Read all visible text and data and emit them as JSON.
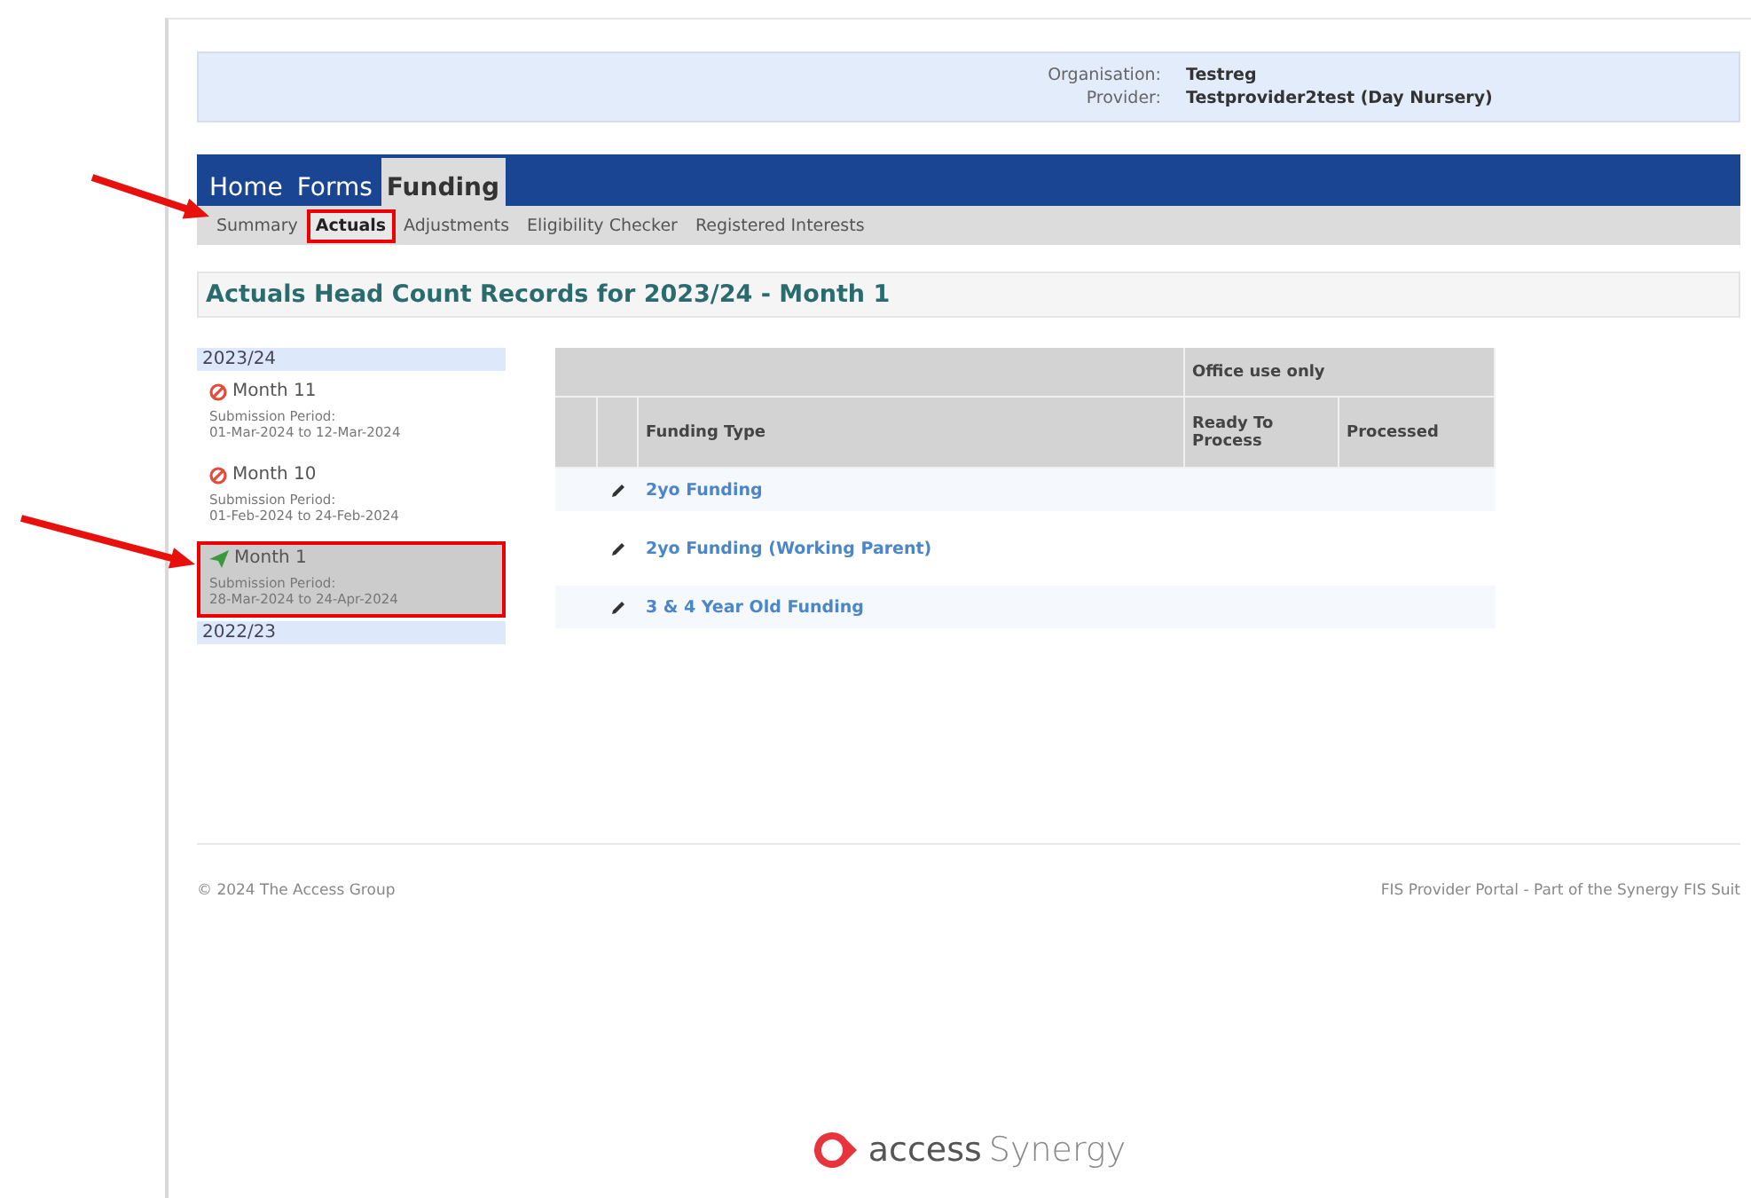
{
  "header": {
    "organisation_label": "Organisation:",
    "organisation": "Testreg",
    "provider_label": "Provider:",
    "provider": "Testprovider2test (Day Nursery)"
  },
  "tabs": [
    {
      "label": "Home",
      "selected": false
    },
    {
      "label": "Forms",
      "selected": false
    },
    {
      "label": "Funding",
      "selected": true
    }
  ],
  "subtabs": [
    {
      "label": "Summary",
      "selected": false,
      "annotated": false
    },
    {
      "label": "Actuals",
      "selected": true,
      "annotated": true
    },
    {
      "label": "Adjustments",
      "selected": false,
      "annotated": false
    },
    {
      "label": "Eligibility Checker",
      "selected": false,
      "annotated": false
    },
    {
      "label": "Registered Interests",
      "selected": false,
      "annotated": false
    }
  ],
  "page_title": "Actuals Head Count Records for 2023/24 - Month 1",
  "periods": [
    {
      "year": "2023/24",
      "children": [
        {
          "label": "Month 11",
          "kind": "rejected",
          "caption": "Submission Period:",
          "dates": "01-Mar-2024 to 12-Mar-2024",
          "selected": false,
          "annotated": false
        },
        {
          "label": "Month 10",
          "kind": "rejected",
          "caption": "Submission Period:",
          "dates": "01-Feb-2024 to 24-Feb-2024",
          "selected": false,
          "annotated": false
        },
        {
          "label": "Month 1",
          "kind": "submitted",
          "caption": "Submission Period:",
          "dates": "28-Mar-2024 to 24-Apr-2024",
          "selected": true,
          "annotated": true
        }
      ]
    },
    {
      "year": "2022/23"
    }
  ],
  "table": {
    "group_heading": "Office use only",
    "columns": [
      "Funding Type",
      "Ready To Process",
      "Processed"
    ],
    "rows": [
      {
        "funding_type": "2yo Funding"
      },
      {
        "funding_type": "2yo Funding (Working Parent)"
      },
      {
        "funding_type": "3 & 4 Year Old Funding"
      }
    ]
  },
  "footer": {
    "copyright": "© 2024 The Access Group",
    "portal": "FIS Provider Portal - Part of the Synergy FIS Suit"
  },
  "logo": {
    "brand": "access",
    "product": "Synergy"
  }
}
